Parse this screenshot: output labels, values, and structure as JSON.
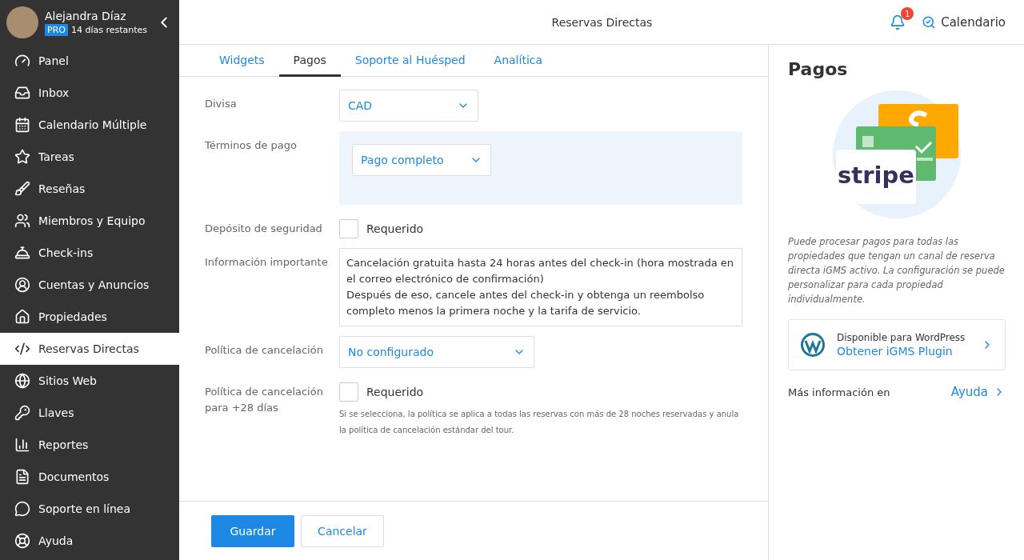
{
  "user": {
    "name": "Alejandra Díaz",
    "plan": "PRO",
    "trial": "14 días restantes"
  },
  "sidebar": {
    "items": [
      {
        "label": "Panel",
        "selected": false
      },
      {
        "label": "Inbox",
        "selected": false
      },
      {
        "label": "Calendario Múltiple",
        "selected": false
      },
      {
        "label": "Tareas",
        "selected": false
      },
      {
        "label": "Reseñas",
        "selected": false
      },
      {
        "label": "Miembros y Equipo",
        "selected": false
      },
      {
        "label": "Check-ins",
        "selected": false
      },
      {
        "label": "Cuentas y Anuncios",
        "selected": false
      },
      {
        "label": "Propiedades",
        "selected": false
      },
      {
        "label": "Reservas Directas",
        "selected": true
      },
      {
        "label": "Sitios Web",
        "selected": false
      },
      {
        "label": "Llaves",
        "selected": false
      },
      {
        "label": "Reportes",
        "selected": false
      },
      {
        "label": "Documentos",
        "selected": false
      },
      {
        "label": "Soporte en línea",
        "selected": false
      },
      {
        "label": "Ayuda",
        "selected": false
      }
    ]
  },
  "header": {
    "title": "Reservas Directas",
    "notifications": "1",
    "calendar": "Calendario"
  },
  "tabs": [
    {
      "label": "Widgets",
      "selected": false
    },
    {
      "label": "Pagos",
      "selected": true
    },
    {
      "label": "Soporte al Huésped",
      "selected": false
    },
    {
      "label": "Analítica",
      "selected": false
    }
  ],
  "form": {
    "fields": [
      {
        "kind": "select",
        "label": "Divisa",
        "value": "CAD"
      },
      {
        "kind": "panel-select",
        "label": "Términos de pago",
        "value": "Pago completo"
      },
      {
        "kind": "checkbox",
        "label": "Depósito de seguridad",
        "option": "Requerido",
        "checked": false
      },
      {
        "kind": "textarea",
        "label": "Información importante",
        "lines": [
          "Cancelación gratuita hasta 24 horas antes del check-in (hora mostrada en el correo electrónico de confirmación)",
          "Después de eso, cancele antes del check-in y obtenga un reembolso completo menos la primera noche y la tarifa de servicio."
        ]
      },
      {
        "kind": "wide-select",
        "label": "Política de cancelación",
        "value": "No configurado"
      },
      {
        "kind": "checkbox",
        "label": "Política de cancelación para +28 días",
        "option": "Requerido",
        "checked": false,
        "hint": "Si se selecciona, la política se aplica a todas las reservas con más de 28 noches reservadas y anula la política de cancelación estándar del tour."
      }
    ]
  },
  "buttons": {
    "save": "Guardar",
    "cancel": "Cancelar"
  },
  "panel": {
    "title": "Pagos",
    "logo_text": "stripe",
    "description": "Puede procesar pagos para todas las propiedades que tengan un canal de reserva directa iGMS activo. La configuración se puede personalizar para cada propiedad individualmente.",
    "plugin_caption": "Disponible para WordPress",
    "plugin_link": "Obtener iGMS Plugin",
    "more_label": "Más información en",
    "more_link": "Ayuda"
  }
}
